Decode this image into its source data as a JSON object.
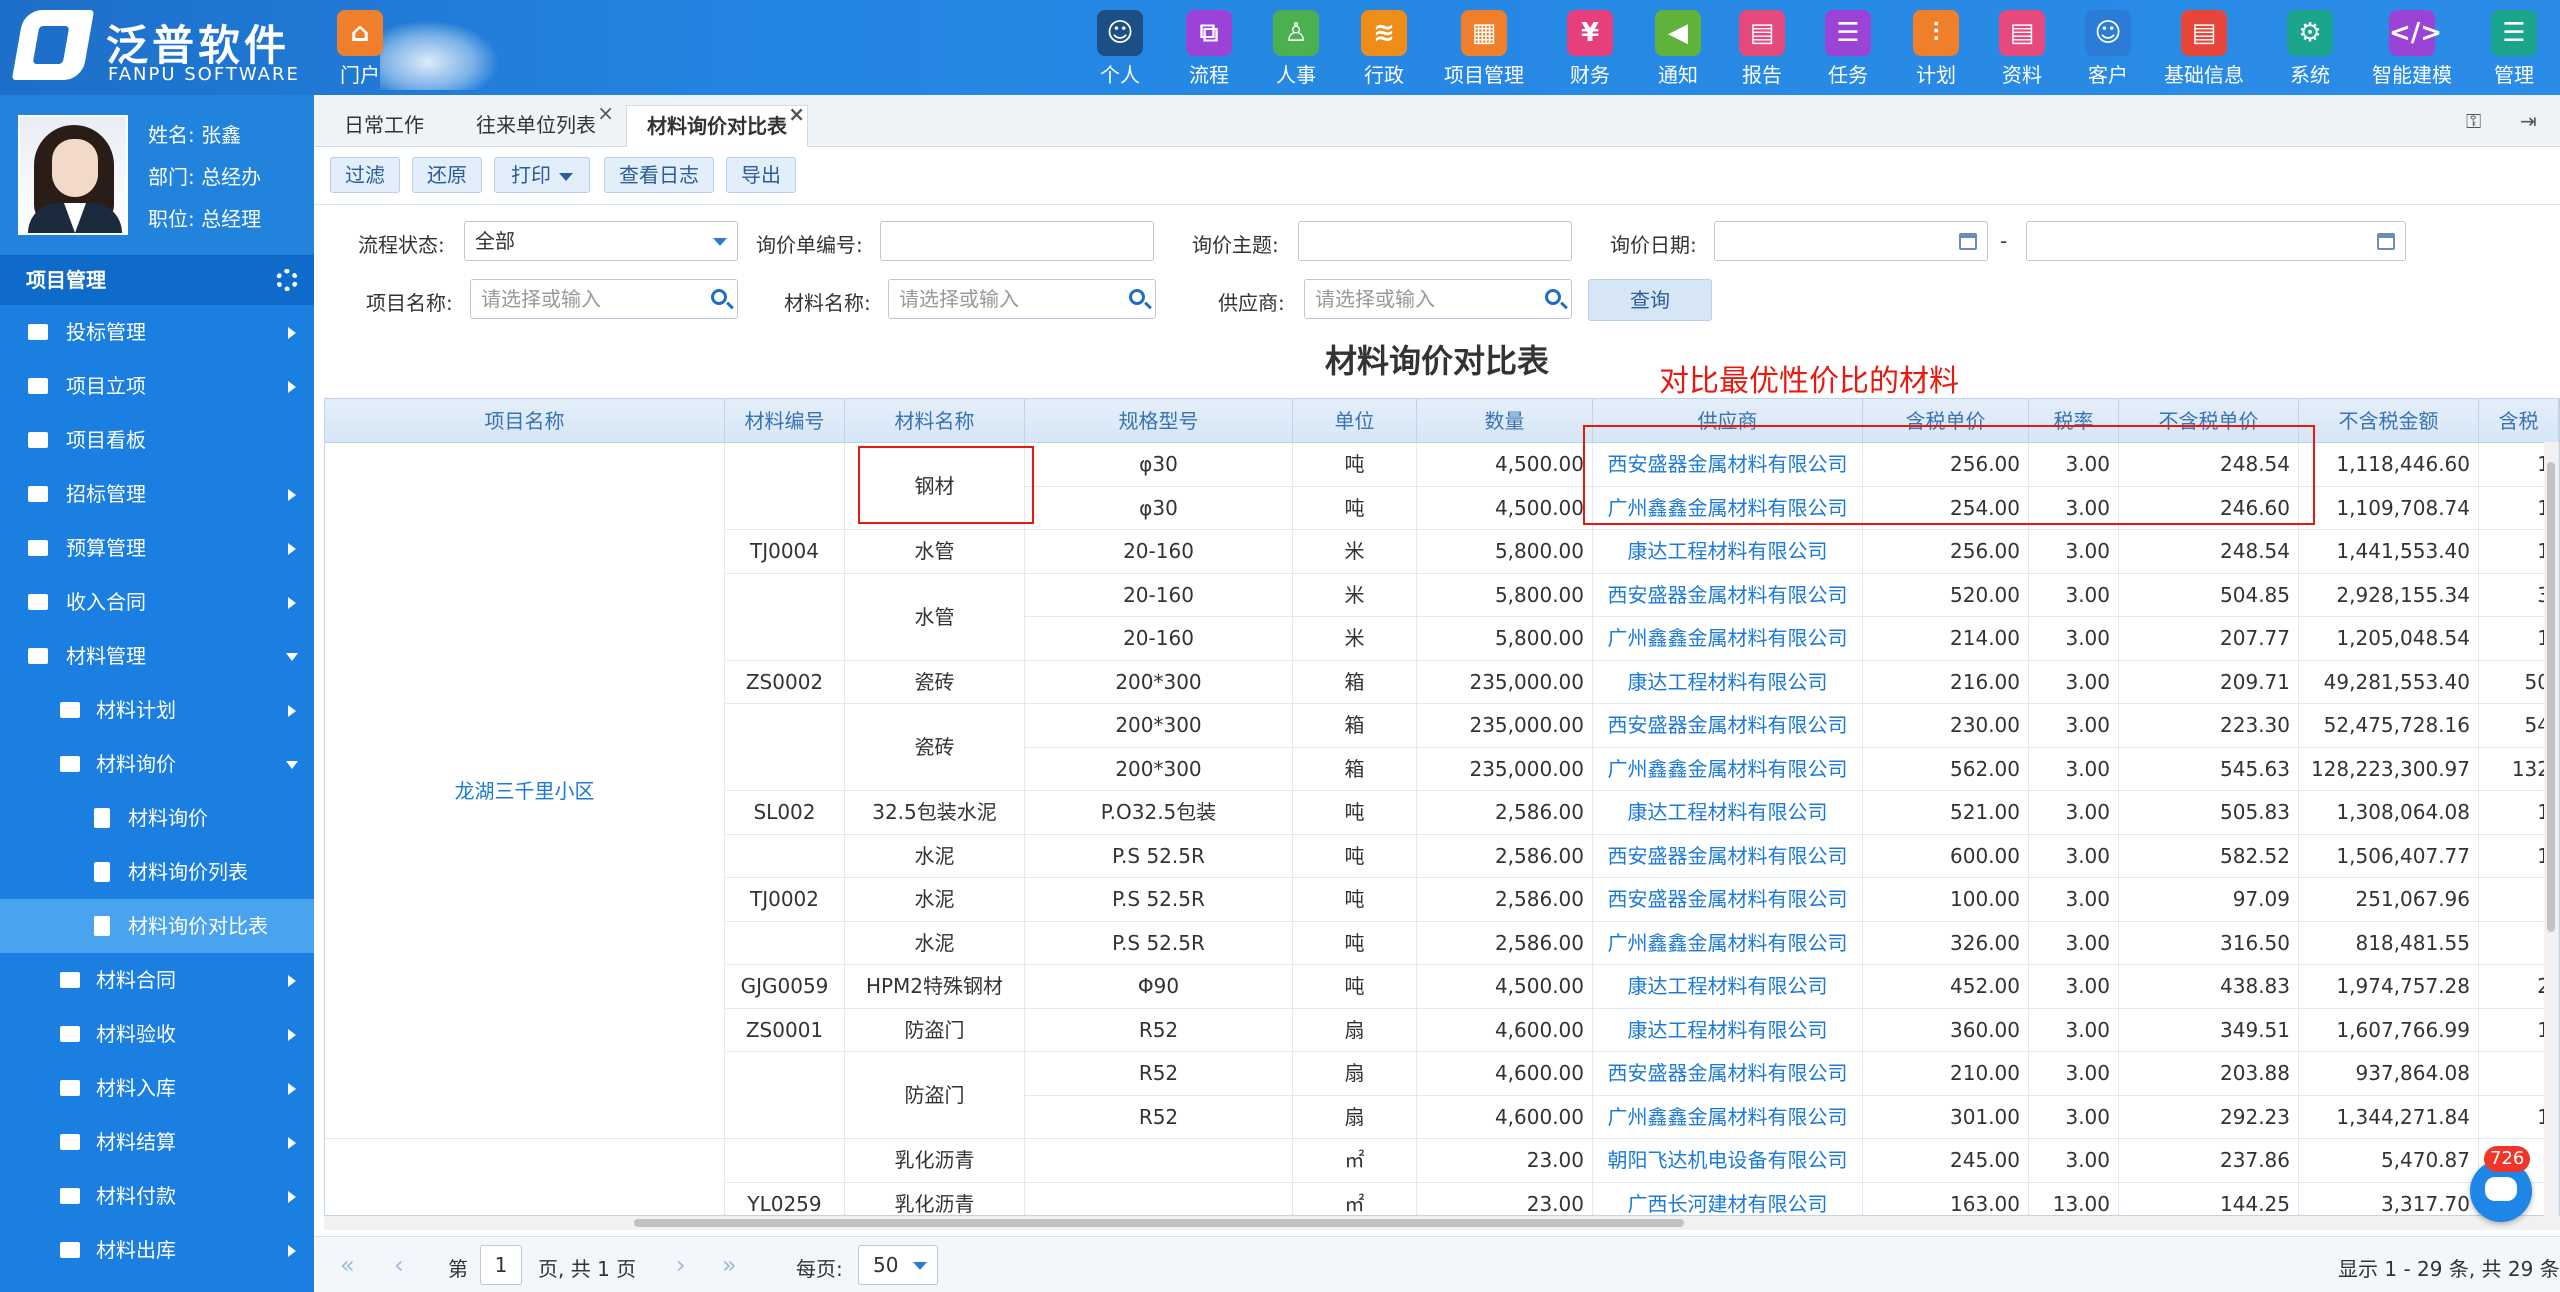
{
  "brand": {
    "cn": "泛普软件",
    "en": "FANPU SOFTWARE"
  },
  "topnav": [
    {
      "label": "门户",
      "icon": "home-icon",
      "color": "#f07f2c",
      "glyph": "⌂"
    },
    {
      "label": "个人",
      "icon": "person-icon",
      "color": "#1c4f86",
      "glyph": "☺"
    },
    {
      "label": "流程",
      "icon": "flow-icon",
      "color": "#9a43d6",
      "glyph": "⧉"
    },
    {
      "label": "人事",
      "icon": "hr-icon",
      "color": "#4caf50",
      "glyph": "♙"
    },
    {
      "label": "行政",
      "icon": "admin-icon",
      "color": "#f08c1a",
      "glyph": "≋"
    },
    {
      "label": "项目管理",
      "icon": "project-icon",
      "color": "#f07f2c",
      "glyph": "▦"
    },
    {
      "label": "财务",
      "icon": "finance-icon",
      "color": "#e63f7c",
      "glyph": "¥"
    },
    {
      "label": "通知",
      "icon": "notice-icon",
      "color": "#5fb33b",
      "glyph": "◀"
    },
    {
      "label": "报告",
      "icon": "report-icon",
      "color": "#e64a7d",
      "glyph": "▤"
    },
    {
      "label": "任务",
      "icon": "task-icon",
      "color": "#9a43d6",
      "glyph": "☰"
    },
    {
      "label": "计划",
      "icon": "plan-icon",
      "color": "#f07f2c",
      "glyph": "⫶"
    },
    {
      "label": "资料",
      "icon": "docs-icon",
      "color": "#e64a7d",
      "glyph": "▤"
    },
    {
      "label": "客户",
      "icon": "customer-icon",
      "color": "#2a7cd6",
      "glyph": "☺"
    },
    {
      "label": "基础信息",
      "icon": "basic-info-icon",
      "color": "#e6463a",
      "glyph": "▤"
    },
    {
      "label": "系统",
      "icon": "system-icon",
      "color": "#1aa58c",
      "glyph": "⚙"
    },
    {
      "label": "智能建模",
      "icon": "modeling-icon",
      "color": "#9a43d6",
      "glyph": "</>"
    },
    {
      "label": "管理",
      "icon": "manage-icon",
      "color": "#1aa58c",
      "glyph": "☰"
    }
  ],
  "profile": {
    "name": "姓名: 张鑫",
    "dept": "部门: 总经办",
    "title": "职位: 总经理"
  },
  "sidebar": {
    "section": "项目管理",
    "items": [
      {
        "label": "投标管理",
        "level": 1,
        "arrow": "right",
        "icon": "bid-icon"
      },
      {
        "label": "项目立项",
        "level": 1,
        "arrow": "right",
        "icon": "project-setup-icon"
      },
      {
        "label": "项目看板",
        "level": 1,
        "arrow": "",
        "icon": "project-board-icon"
      },
      {
        "label": "招标管理",
        "level": 1,
        "arrow": "right",
        "icon": "tender-icon"
      },
      {
        "label": "预算管理",
        "level": 1,
        "arrow": "right",
        "icon": "budget-icon"
      },
      {
        "label": "收入合同",
        "level": 1,
        "arrow": "right",
        "icon": "income-contract-icon"
      },
      {
        "label": "材料管理",
        "level": 1,
        "arrow": "down",
        "icon": "cart-icon"
      },
      {
        "label": "材料计划",
        "level": 2,
        "arrow": "right",
        "icon": "folder-icon"
      },
      {
        "label": "材料询价",
        "level": 2,
        "arrow": "down",
        "icon": "cart-icon"
      },
      {
        "label": "材料询价",
        "level": 3,
        "arrow": "",
        "icon": "file-icon"
      },
      {
        "label": "材料询价列表",
        "level": 3,
        "arrow": "",
        "icon": "file-icon"
      },
      {
        "label": "材料询价对比表",
        "level": 3,
        "arrow": "",
        "icon": "file-icon",
        "active": true
      },
      {
        "label": "材料合同",
        "level": 2,
        "arrow": "right",
        "icon": "folder-icon"
      },
      {
        "label": "材料验收",
        "level": 2,
        "arrow": "right",
        "icon": "cart-icon"
      },
      {
        "label": "材料入库",
        "level": 2,
        "arrow": "right",
        "icon": "folder-icon"
      },
      {
        "label": "材料结算",
        "level": 2,
        "arrow": "right",
        "icon": "folder-icon"
      },
      {
        "label": "材料付款",
        "level": 2,
        "arrow": "right",
        "icon": "folder-icon"
      },
      {
        "label": "材料出库",
        "level": 2,
        "arrow": "right",
        "icon": "folder-icon"
      }
    ]
  },
  "tabs": [
    {
      "label": "日常工作",
      "closable": false,
      "active": false
    },
    {
      "label": "往来单位列表",
      "closable": true,
      "active": false
    },
    {
      "label": "材料询价对比表",
      "closable": true,
      "active": true
    }
  ],
  "toolbar": {
    "filter": "过滤",
    "reset": "还原",
    "print": "打印",
    "log": "查看日志",
    "export": "导出"
  },
  "form": {
    "status_label": "流程状态:",
    "status_value": "全部",
    "no_label": "询价单编号:",
    "no_value": "",
    "subject_label": "询价主题:",
    "subject_value": "",
    "date_label": "询价日期:",
    "date_sep": "-",
    "project_label": "项目名称:",
    "project_ph": "请选择或输入",
    "material_label": "材料名称:",
    "material_ph": "请选择或输入",
    "supplier_label": "供应商:",
    "supplier_ph": "请选择或输入",
    "query": "查询"
  },
  "report_title": "材料询价对比表",
  "annotation": "对比最优性价比的材料",
  "table": {
    "columns": [
      "项目名称",
      "材料编号",
      "材料名称",
      "规格型号",
      "单位",
      "数量",
      "供应商",
      "含税单价",
      "税率",
      "不含税单价",
      "不含税金额",
      "含税"
    ],
    "project": "龙湖三千里小区",
    "rows": [
      [
        "",
        "钢材",
        "φ30",
        "吨",
        "4,500.00",
        "西安盛器金属材料有限公司",
        "256.00",
        "3.00",
        "248.54",
        "1,118,446.60",
        "1"
      ],
      [
        "",
        "钢材",
        "φ30",
        "吨",
        "4,500.00",
        "广州鑫鑫金属材料有限公司",
        "254.00",
        "3.00",
        "246.60",
        "1,109,708.74",
        "1"
      ],
      [
        "TJ0004",
        "水管",
        "20-160",
        "米",
        "5,800.00",
        "康达工程材料有限公司",
        "256.00",
        "3.00",
        "248.54",
        "1,441,553.40",
        "1"
      ],
      [
        "",
        "水管",
        "20-160",
        "米",
        "5,800.00",
        "西安盛器金属材料有限公司",
        "520.00",
        "3.00",
        "504.85",
        "2,928,155.34",
        "3"
      ],
      [
        "",
        "水管",
        "20-160",
        "米",
        "5,800.00",
        "广州鑫鑫金属材料有限公司",
        "214.00",
        "3.00",
        "207.77",
        "1,205,048.54",
        "1"
      ],
      [
        "ZS0002",
        "瓷砖",
        "200*300",
        "箱",
        "235,000.00",
        "康达工程材料有限公司",
        "216.00",
        "3.00",
        "209.71",
        "49,281,553.40",
        "50"
      ],
      [
        "",
        "瓷砖",
        "200*300",
        "箱",
        "235,000.00",
        "西安盛器金属材料有限公司",
        "230.00",
        "3.00",
        "223.30",
        "52,475,728.16",
        "54"
      ],
      [
        "",
        "瓷砖",
        "200*300",
        "箱",
        "235,000.00",
        "广州鑫鑫金属材料有限公司",
        "562.00",
        "3.00",
        "545.63",
        "128,223,300.97",
        "132"
      ],
      [
        "SL002",
        "32.5包装水泥",
        "P.O32.5包装",
        "吨",
        "2,586.00",
        "康达工程材料有限公司",
        "521.00",
        "3.00",
        "505.83",
        "1,308,064.08",
        "1"
      ],
      [
        "",
        "水泥",
        "P.S 52.5R",
        "吨",
        "2,586.00",
        "西安盛器金属材料有限公司",
        "600.00",
        "3.00",
        "582.52",
        "1,506,407.77",
        "1"
      ],
      [
        "TJ0002",
        "水泥",
        "P.S 52.5R",
        "吨",
        "2,586.00",
        "西安盛器金属材料有限公司",
        "100.00",
        "3.00",
        "97.09",
        "251,067.96",
        ""
      ],
      [
        "",
        "水泥",
        "P.S 52.5R",
        "吨",
        "2,586.00",
        "广州鑫鑫金属材料有限公司",
        "326.00",
        "3.00",
        "316.50",
        "818,481.55",
        ""
      ],
      [
        "GJG0059",
        "HPM2特殊钢材",
        "Φ90",
        "吨",
        "4,500.00",
        "康达工程材料有限公司",
        "452.00",
        "3.00",
        "438.83",
        "1,974,757.28",
        "2"
      ],
      [
        "ZS0001",
        "防盗门",
        "R52",
        "扇",
        "4,600.00",
        "康达工程材料有限公司",
        "360.00",
        "3.00",
        "349.51",
        "1,607,766.99",
        "1"
      ],
      [
        "",
        "防盗门",
        "R52",
        "扇",
        "4,600.00",
        "西安盛器金属材料有限公司",
        "210.00",
        "3.00",
        "203.88",
        "937,864.08",
        ""
      ],
      [
        "",
        "防盗门",
        "R52",
        "扇",
        "4,600.00",
        "广州鑫鑫金属材料有限公司",
        "301.00",
        "3.00",
        "292.23",
        "1,344,271.84",
        "1"
      ],
      [
        "",
        "乳化沥青",
        "",
        "㎡",
        "23.00",
        "朝阳飞达机电设备有限公司",
        "245.00",
        "3.00",
        "237.86",
        "5,470.87",
        ""
      ],
      [
        "YL0259",
        "乳化沥青",
        "",
        "㎡",
        "23.00",
        "广西长河建材有限公司",
        "163.00",
        "13.00",
        "144.25",
        "3,317.70",
        ""
      ]
    ]
  },
  "pager": {
    "page_label": "第",
    "page": "1",
    "of": "页, 共 1 页",
    "per_label": "每页:",
    "per": "50",
    "summary": "显示 1 - 29 条, 共 29 条"
  },
  "chat_badge": "726"
}
